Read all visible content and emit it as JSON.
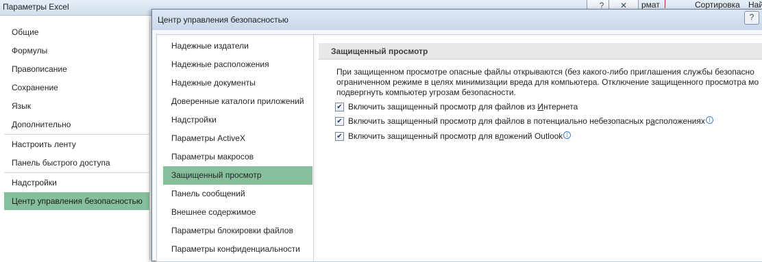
{
  "background_window": {
    "title": "Параметры Excel",
    "ribbon": {
      "format_fragment": "рмат",
      "sort_label": "Сортировка",
      "find_fragment": "Най"
    },
    "controls": {
      "help": "?",
      "close": "✕"
    },
    "nav_items": [
      "Общие",
      "Формулы",
      "Правописание",
      "Сохранение",
      "Язык",
      "Дополнительно",
      "Настроить ленту",
      "Панель быстрого доступа",
      "Надстройки",
      "Центр управления безопасностью"
    ],
    "selected": "Центр управления безопасностью"
  },
  "dialog": {
    "title": "Центр управления безопасностью",
    "help_button": "?",
    "nav_items": [
      "Надежные издатели",
      "Надежные расположения",
      "Надежные документы",
      "Доверенные каталоги приложений",
      "Надстройки",
      "Параметры ActiveX",
      "Параметры макросов",
      "Защищенный просмотр",
      "Панель сообщений",
      "Внешнее содержимое",
      "Параметры блокировки файлов",
      "Параметры конфиденциальности"
    ],
    "selected": "Защищенный просмотр",
    "section": {
      "title": "Защищенный просмотр",
      "description_lines": [
        "При защищенном просмотре опасные файлы открываются (без какого-либо приглашения службы безопасно",
        "ограниченном режиме в целях минимизации вреда для компьютера. Отключение защищенного просмотра мо",
        "подвергнуть компьютер угрозам безопасности."
      ],
      "options": [
        {
          "pre": "Включить защищенный просмотр для файлов из ",
          "accel": "И",
          "post": "нтернета",
          "checked": true,
          "info": false
        },
        {
          "pre": "Включить защищенный просмотр для файлов в потенциально небезопасных р",
          "accel": "а",
          "post": "сположениях",
          "checked": true,
          "info": true
        },
        {
          "pre": "Включить защищенный просмотр для в",
          "accel": "л",
          "post": "ожений Outlook",
          "checked": true,
          "info": true
        }
      ]
    }
  },
  "icons": {
    "checkbox_checked": "check-mark",
    "info": "info-circle-icon"
  }
}
